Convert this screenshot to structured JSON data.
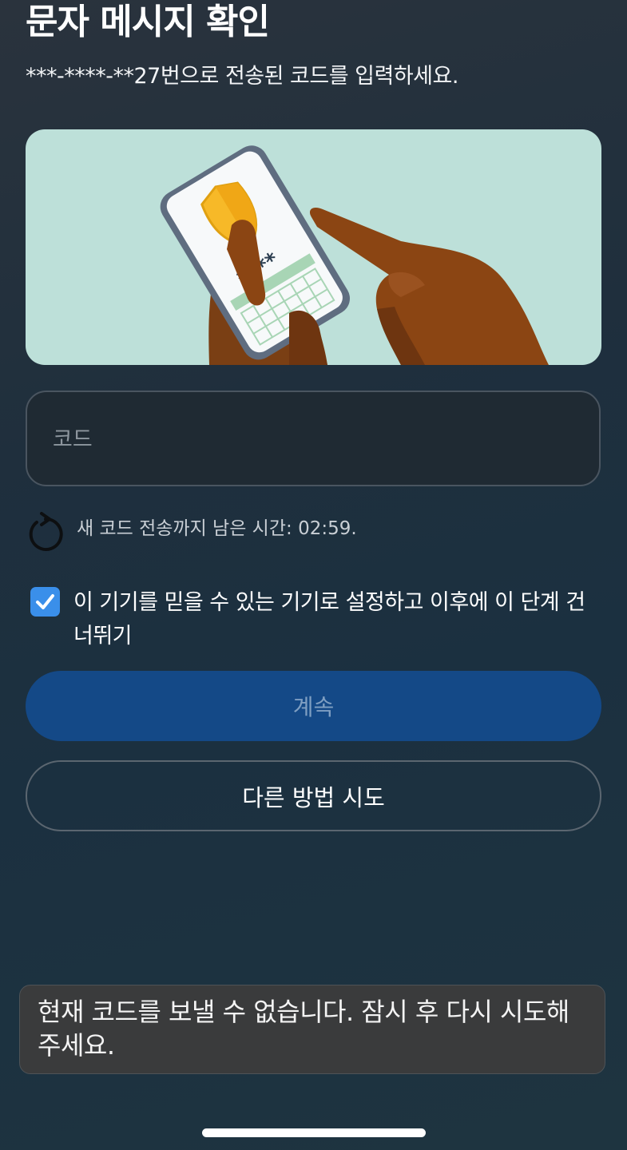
{
  "header": {
    "title": "문자 메시지 확인",
    "subtitle": "***-****-**27번으로 전송된 코드를 입력하세요."
  },
  "illustration": {
    "name": "phone-security-illustration",
    "masked_code": "****",
    "colors": {
      "background": "#bde0d9",
      "shield": "#f7b928",
      "skin": "#8b4513",
      "phone_frame": "#5f6d80"
    }
  },
  "code_field": {
    "placeholder": "코드",
    "value": ""
  },
  "resend": {
    "icon": "refresh-icon",
    "text": "새 코드 전송까지 남은 시간: 02:59."
  },
  "trust_device": {
    "checked": true,
    "label": "이 기기를 믿을 수 있는 기기로 설정하고 이후에 이 단계 건너뛰기"
  },
  "buttons": {
    "continue_label": "계속",
    "other_method_label": "다른 방법 시도"
  },
  "toast": {
    "message": "현재 코드를 보낼 수 없습니다. 잠시 후 다시 시도해 주세요."
  },
  "colors": {
    "primary_button": "#144987",
    "primary_button_text": "#7f9fc2",
    "checkbox": "#3a8fea",
    "toast_background": "#3a3b3c"
  }
}
